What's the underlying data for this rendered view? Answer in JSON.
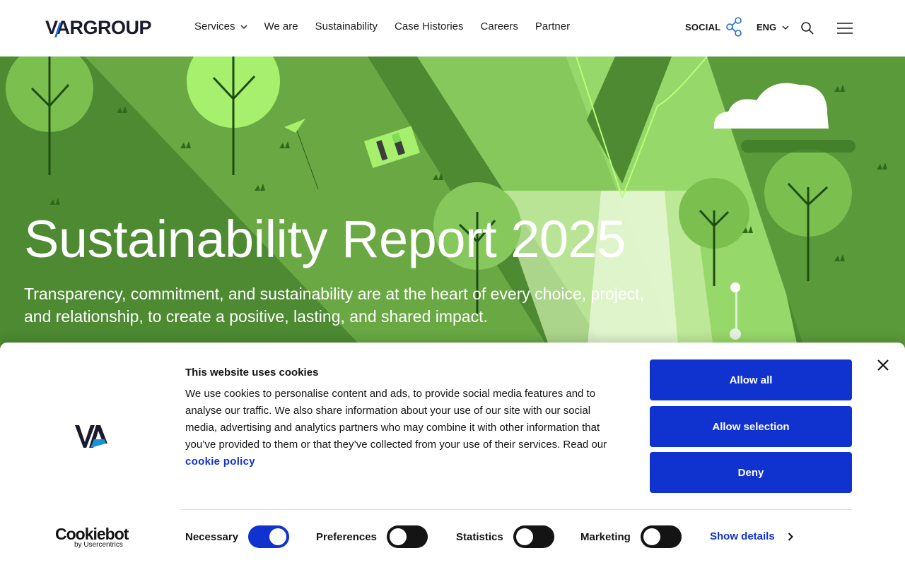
{
  "header": {
    "logo_text": "VARGROUP",
    "nav": [
      {
        "label": "Services",
        "has_dropdown": true
      },
      {
        "label": "We are"
      },
      {
        "label": "Sustainability"
      },
      {
        "label": "Case Histories"
      },
      {
        "label": "Careers"
      },
      {
        "label": "Partner"
      }
    ],
    "social_label": "SOCIAL",
    "language": "ENG",
    "icons": [
      "share-network-icon",
      "chevron-down-icon",
      "search-icon",
      "hamburger-menu-icon"
    ]
  },
  "hero": {
    "title": "Sustainability Report 2025",
    "subtitle": "Transparency, commitment, and sustainability are at the heart of every choice, project, and relationship, to create a positive, lasting, and shared impact."
  },
  "cookie_banner": {
    "title": "This website uses cookies",
    "text": "We use cookies to personalise content and ads, to provide social media features and to analyse our traffic. We also share information about your use of our site with our social media, advertising and analytics partners who may combine it with other information that you’ve provided to them or that they’ve collected from your use of their services. Read our ",
    "link_label": "cookie policy",
    "buttons": {
      "allow_all": "Allow all",
      "allow_selection": "Allow selection",
      "deny": "Deny"
    },
    "brand": {
      "main": "Cookiebot",
      "sub": "by Usercentrics"
    },
    "toggles": [
      {
        "label": "Necessary",
        "checked": true
      },
      {
        "label": "Preferences",
        "checked": false
      },
      {
        "label": "Statistics",
        "checked": false
      },
      {
        "label": "Marketing",
        "checked": false
      }
    ],
    "show_details": "Show details"
  },
  "colors": {
    "accent": "#1032cf",
    "hero_green": "#4d8a32",
    "light_green": "#a8e27a"
  }
}
